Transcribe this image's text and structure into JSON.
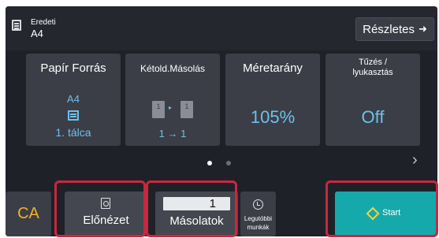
{
  "header": {
    "original_label": "Eredeti",
    "original_value": "A4",
    "details_label": "Részletes",
    "details_arrow": "➜"
  },
  "tiles": [
    {
      "title": "Papír Forrás",
      "size": "A4",
      "tray": "1. tálca"
    },
    {
      "title": "Kétold.Másolás",
      "page_a": "1",
      "page_b": "1",
      "arrow": "▸",
      "mode": "1 → 1"
    },
    {
      "title": "Méretarány",
      "value": "105%"
    },
    {
      "title": "Tűzés /\nlyukasztás",
      "value": "Off"
    }
  ],
  "pager": {
    "active_page": 1,
    "total_pages": 2,
    "next_arrow": "›"
  },
  "bottom": {
    "ca_label": "CA",
    "preview_label": "Előnézet",
    "copies_value": "1",
    "copies_label": "Másolatok",
    "recent_label": "Legutóbbi munkák",
    "start_label": "Start"
  },
  "colors": {
    "accent_blue": "#6ec0ea",
    "start_teal": "#16a9ac",
    "ca_yellow": "#f2b227",
    "highlight_red": "#c8283f"
  }
}
